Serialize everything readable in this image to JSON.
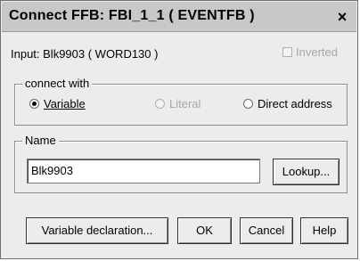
{
  "title": "Connect FFB:  FBI_1_1  ( EVENTFB )",
  "close_glyph": "×",
  "input_label": "Input: Blk9903 ( WORD130 )",
  "inverted_label": "Inverted",
  "connect_with": {
    "legend": "connect with",
    "variable": "Variable",
    "literal": "Literal",
    "direct_address": "Direct address",
    "selected": "variable"
  },
  "name": {
    "legend": "Name",
    "value": "Blk9903",
    "lookup_button": "Lookup..."
  },
  "buttons": {
    "variable_declaration": "Variable declaration...",
    "ok": "OK",
    "cancel": "Cancel",
    "help": "Help"
  }
}
